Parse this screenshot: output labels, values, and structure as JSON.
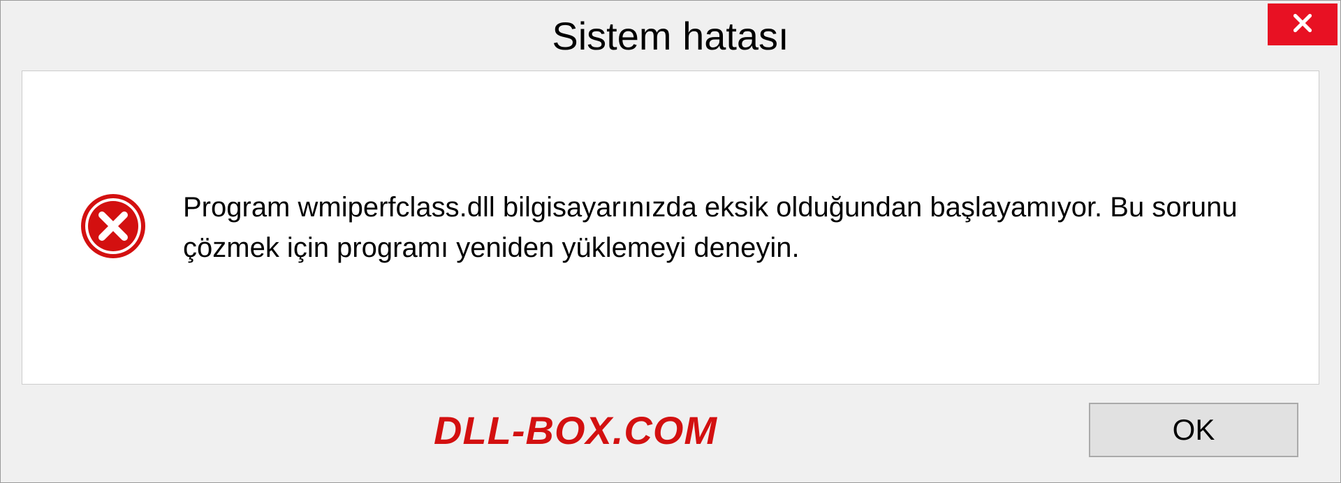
{
  "titlebar": {
    "title": "Sistem hatası"
  },
  "message": {
    "text": "Program wmiperfclass.dll bilgisayarınızda eksik olduğundan başlayamıyor. Bu sorunu çözmek için programı yeniden yüklemeyi deneyin."
  },
  "footer": {
    "watermark": "DLL-BOX.COM",
    "ok_label": "OK"
  }
}
